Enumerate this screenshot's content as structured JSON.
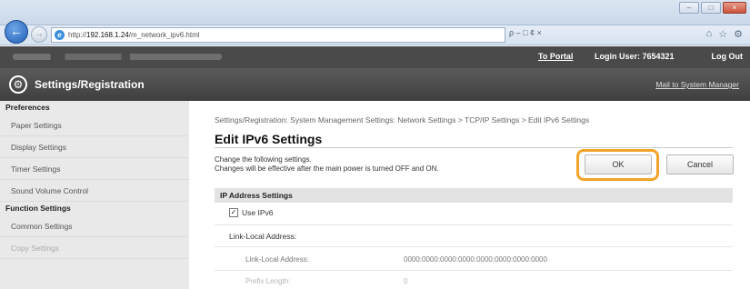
{
  "browser": {
    "address_prefix": "http://",
    "address_host": "192.168.1.24",
    "address_path": "/m_network_ipv6.html",
    "address_tools": "ρ – □ ¢ ×",
    "window_buttons": [
      "–",
      "□",
      "×"
    ],
    "icons": [
      "home-icon",
      "star-icon",
      "gear-icon"
    ]
  },
  "portal": {
    "to_portal": "To Portal",
    "login_user": "Login User:  7654321",
    "logout": "Log Out"
  },
  "header": {
    "title": "Settings/Registration",
    "mail_admin": "Mail to System Manager"
  },
  "sidebar": {
    "groups": [
      {
        "title": "Preferences",
        "items": [
          "Paper Settings",
          "Display Settings",
          "Timer Settings",
          "Sound Volume Control"
        ]
      },
      {
        "title": "Function Settings",
        "items": [
          "Common Settings",
          "Copy Settings"
        ]
      }
    ]
  },
  "main": {
    "breadcrumb": "Settings/Registration: System Management Settings: Network Settings > TCP/IP Settings > Edit IPv6 Settings",
    "title": "Edit IPv6 Settings",
    "desc_line1": "Change the following settings.",
    "desc_line2": "Changes will be effective after the main power is turned OFF and ON.",
    "ok_label": "OK",
    "cancel_label": "Cancel",
    "section_title": "IP Address Settings",
    "use_ipv6_label": "Use IPv6",
    "use_ipv6_checked": true,
    "link_local_heading": "Link-Local Address:",
    "link_local_label": "Link-Local Address:",
    "link_local_value": "0000:0000:0000:0000:0000:0000:0000:0000",
    "prefix_label": "Prefix Length:",
    "prefix_value": "0"
  },
  "colors": {
    "highlight_ring": "#f2a428",
    "header_bg": "#4a4a4a",
    "sidebar_bg": "#e9e9e9"
  }
}
